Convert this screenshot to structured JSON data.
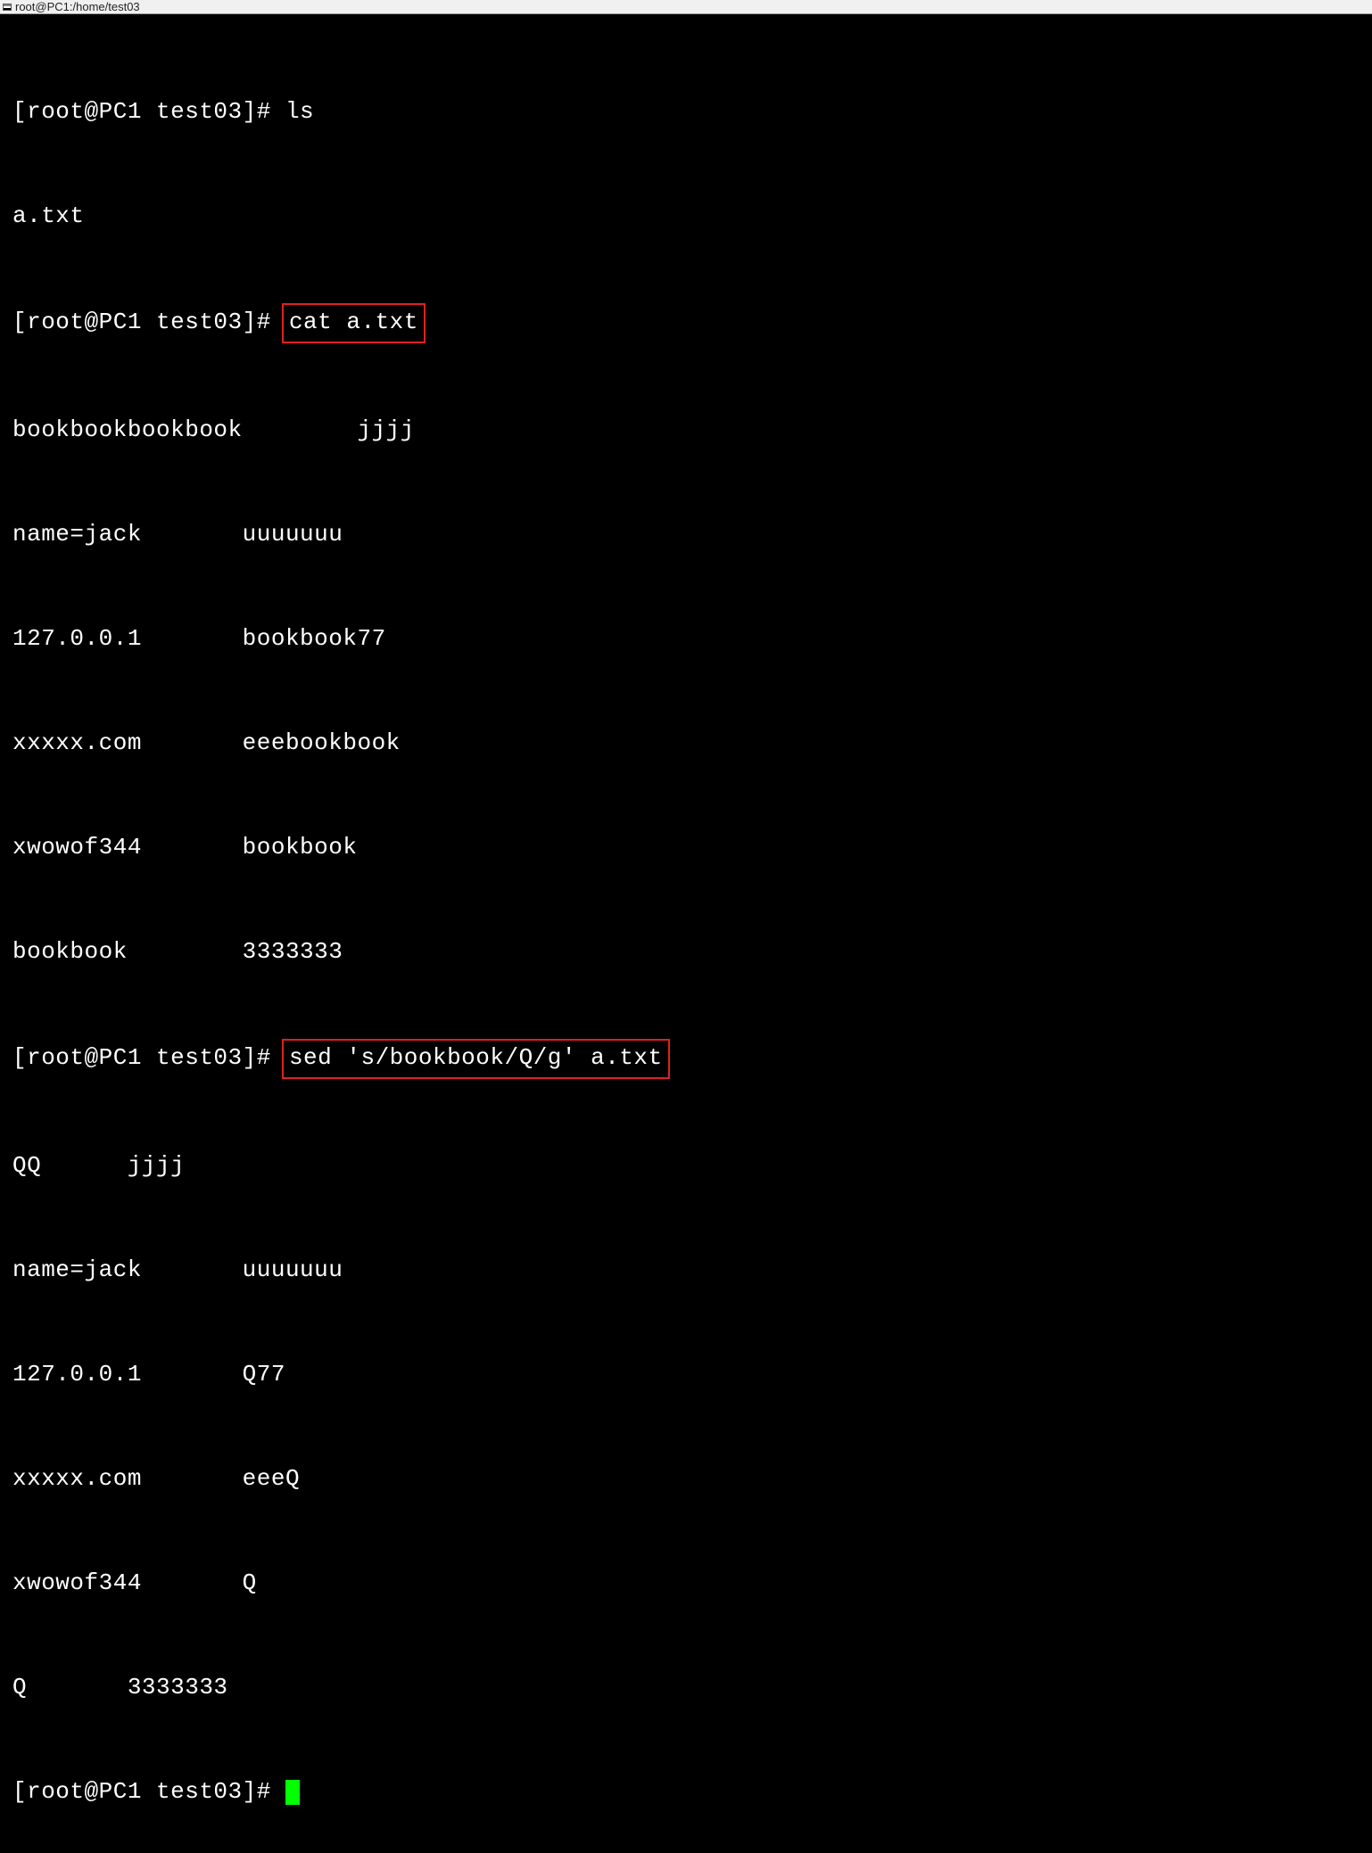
{
  "titlebar": {
    "text": "root@PC1:/home/test03"
  },
  "terminal": {
    "prompt": "[root@PC1 test03]# ",
    "commands": {
      "ls": "ls",
      "cat": "cat a.txt",
      "sed": "sed 's/bookbook/Q/g' a.txt"
    },
    "output": {
      "ls_result": "a.txt",
      "cat_l1": "bookbookbookbook        jjjj",
      "cat_l2": "name=jack       uuuuuuu",
      "cat_l3": "127.0.0.1       bookbook77",
      "cat_l4": "xxxxx.com       eeebookbook",
      "cat_l5": "xwowof344       bookbook",
      "cat_l6": "bookbook        3333333",
      "sed_l1": "QQ      jjjj",
      "sed_l2": "name=jack       uuuuuuu",
      "sed_l3": "127.0.0.1       Q77",
      "sed_l4": "xxxxx.com       eeeQ",
      "sed_l5": "xwowof344       Q",
      "sed_l6": "Q       3333333"
    }
  }
}
